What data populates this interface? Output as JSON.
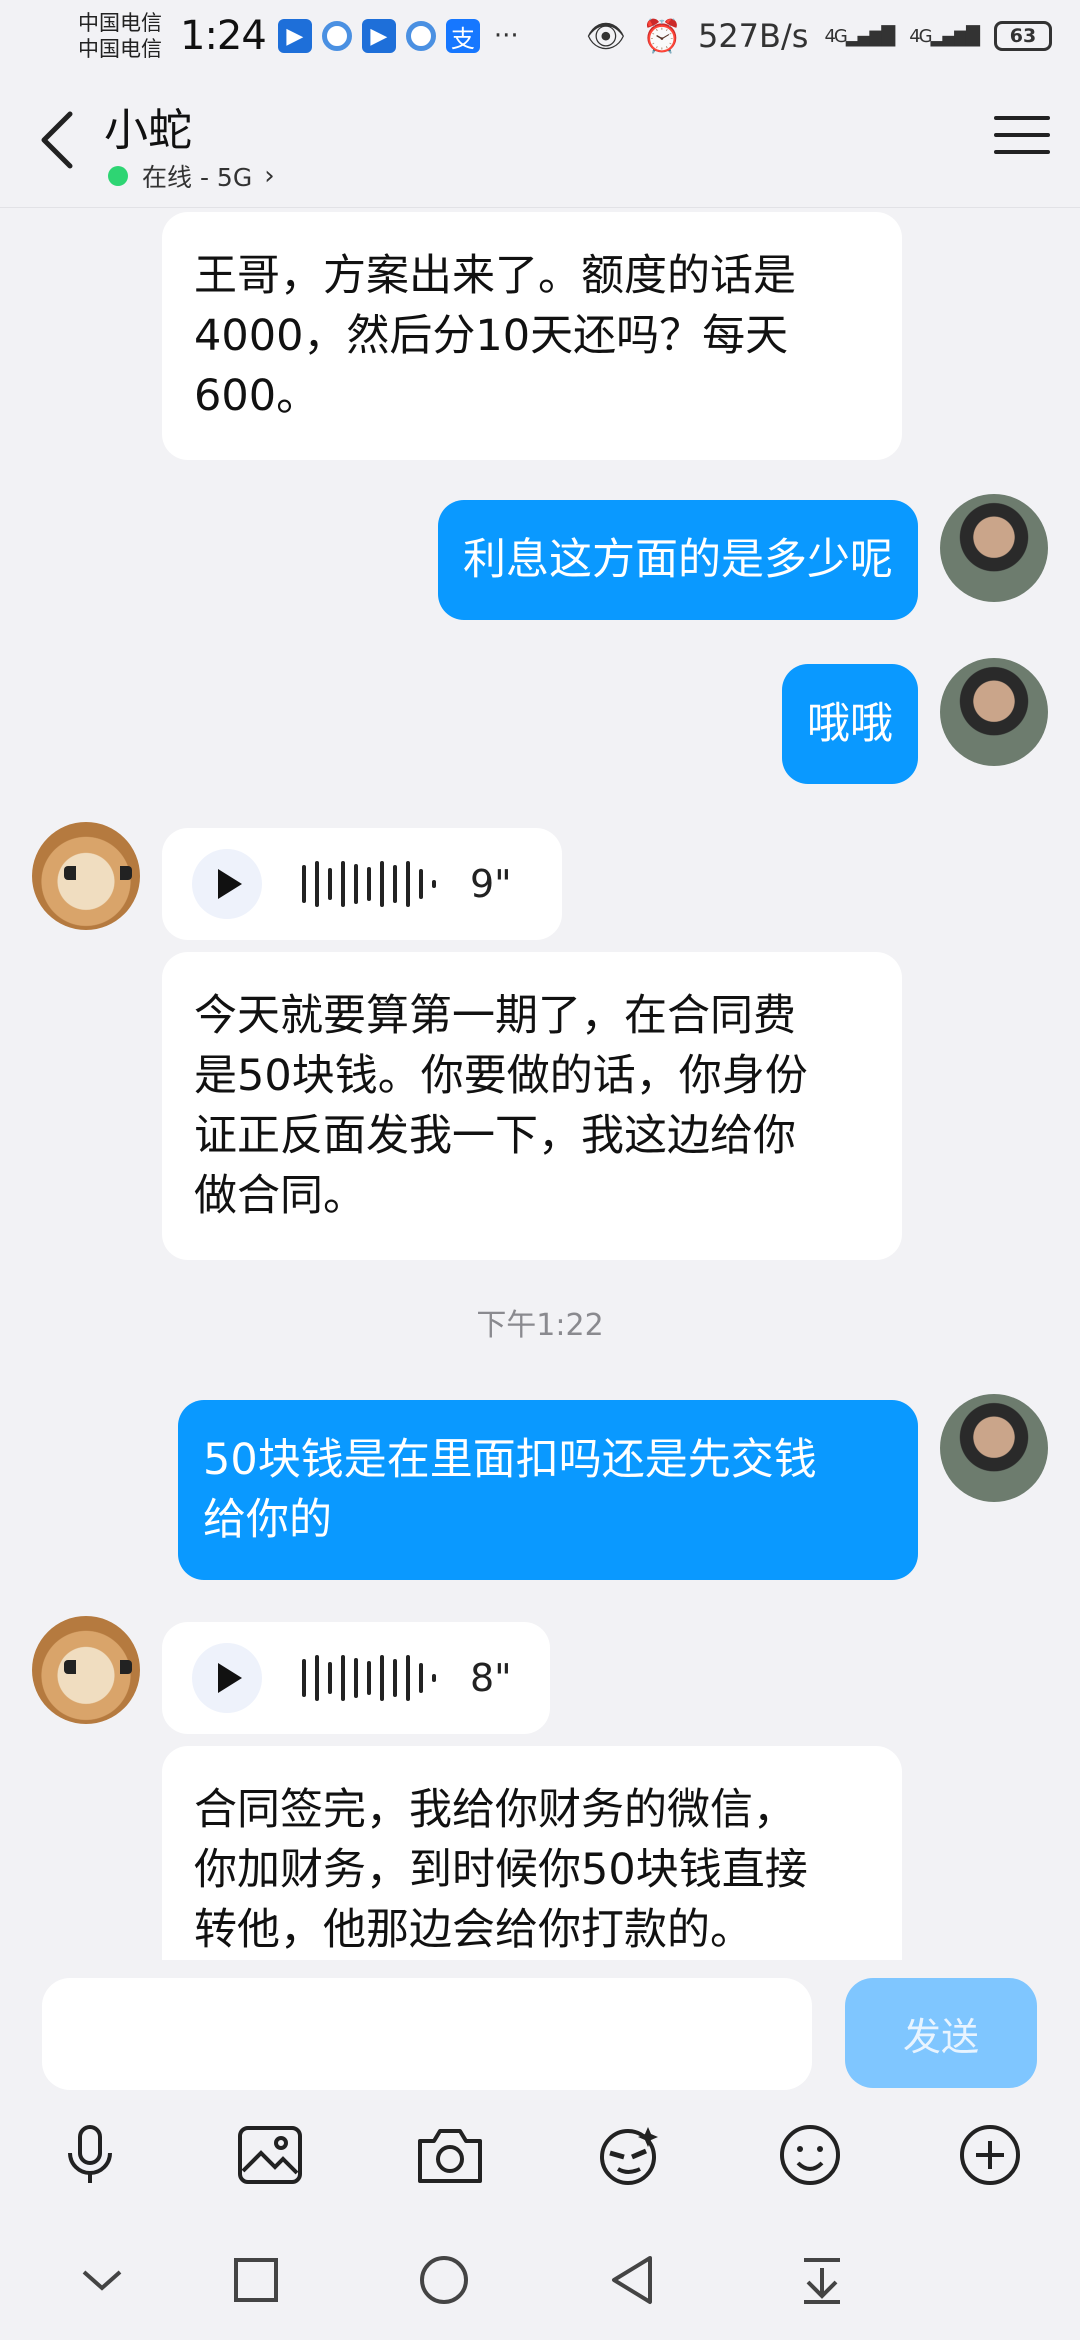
{
  "status": {
    "carrier1": "中国电信",
    "carrier2": "中国电信",
    "time": "1:24",
    "more": "···",
    "speed": "527B/s",
    "network1": "4G",
    "network2": "4G",
    "battery": "63"
  },
  "header": {
    "name": "小蛇",
    "presence": "在线 - 5G",
    "chevron": "›"
  },
  "messages": {
    "m1": {
      "lines": [
        "王哥，方案出来了。额度的话是",
        "4000，然后分10天还吗？每天",
        "600。"
      ]
    },
    "m2": "利息这方面的是多少呢",
    "m3": "哦哦",
    "v1": "9\"",
    "m4": {
      "lines": [
        "今天就要算第一期了，在合同费",
        "是50块钱。你要做的话，你身份",
        "证正反面发我一下，我这边给你",
        "做合同。"
      ]
    },
    "time": "下午1:22",
    "m5": {
      "lines": [
        "50块钱是在里面扣吗还是先交钱",
        "给你的"
      ]
    },
    "v2": "8\"",
    "m6": {
      "lines": [
        "合同签完，我给你财务的微信，",
        "你加财务，到时候你50块钱直接",
        "转他，他那边会给你打款的。"
      ]
    }
  },
  "input": {
    "send": "发送",
    "placeholder": ""
  },
  "icons": {
    "toolbar": [
      "mic-icon",
      "image-icon",
      "camera-icon",
      "sticker-icon",
      "emoji-icon",
      "plus-icon"
    ],
    "nav": [
      "collapse-icon",
      "recents-icon",
      "home-icon",
      "back-icon",
      "download-icon"
    ]
  }
}
